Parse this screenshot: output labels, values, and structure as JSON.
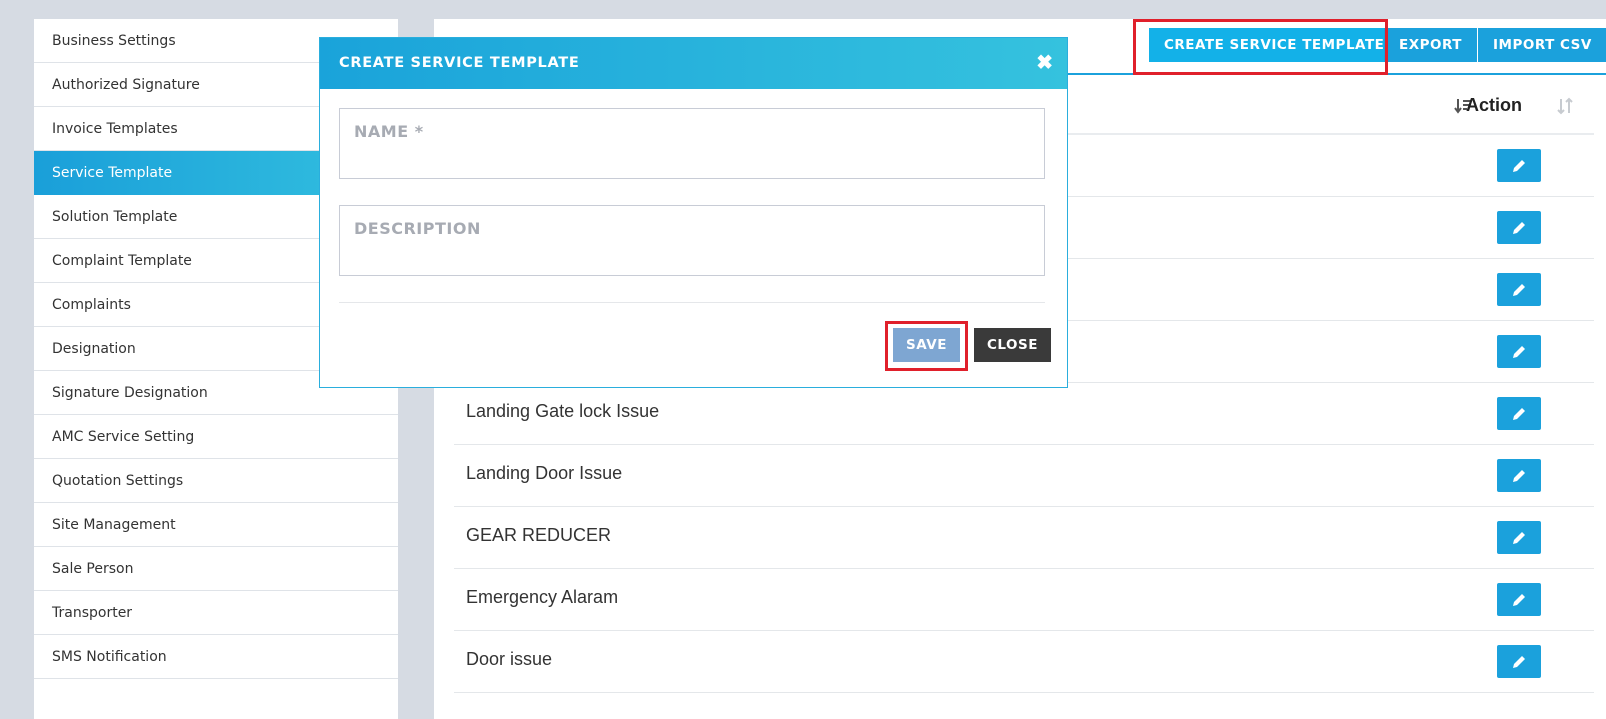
{
  "sidebar": {
    "items": [
      {
        "label": "Business Settings"
      },
      {
        "label": "Authorized Signature"
      },
      {
        "label": "Invoice Templates"
      },
      {
        "label": "Service Template",
        "active": true
      },
      {
        "label": "Solution Template"
      },
      {
        "label": "Complaint Template"
      },
      {
        "label": "Complaints"
      },
      {
        "label": "Designation"
      },
      {
        "label": "Signature Designation"
      },
      {
        "label": "AMC Service Setting"
      },
      {
        "label": "Quotation Settings"
      },
      {
        "label": "Site Management"
      },
      {
        "label": "Sale Person"
      },
      {
        "label": "Transporter"
      },
      {
        "label": "SMS Notification"
      }
    ]
  },
  "toolbar": {
    "create_label": "CREATE SERVICE TEMPLATE",
    "export_label": "EXPORT",
    "import_label": "IMPORT CSV"
  },
  "table": {
    "action_header": "Action",
    "rows": [
      {
        "name": ""
      },
      {
        "name": ""
      },
      {
        "name": ""
      },
      {
        "name": ""
      },
      {
        "name": "Landing Gate lock Issue"
      },
      {
        "name": "Landing Door Issue"
      },
      {
        "name": "GEAR REDUCER"
      },
      {
        "name": "Emergency Alaram"
      },
      {
        "name": "Door issue"
      }
    ]
  },
  "modal": {
    "title": "CREATE SERVICE TEMPLATE",
    "name_placeholder": "NAME *",
    "description_placeholder": "DESCRIPTION",
    "save_label": "SAVE",
    "close_label": "CLOSE"
  },
  "colors": {
    "accent": "#1ba1dc",
    "highlight": "#e0202b",
    "save": "#7ea6d2",
    "close": "#3a3a3a"
  }
}
